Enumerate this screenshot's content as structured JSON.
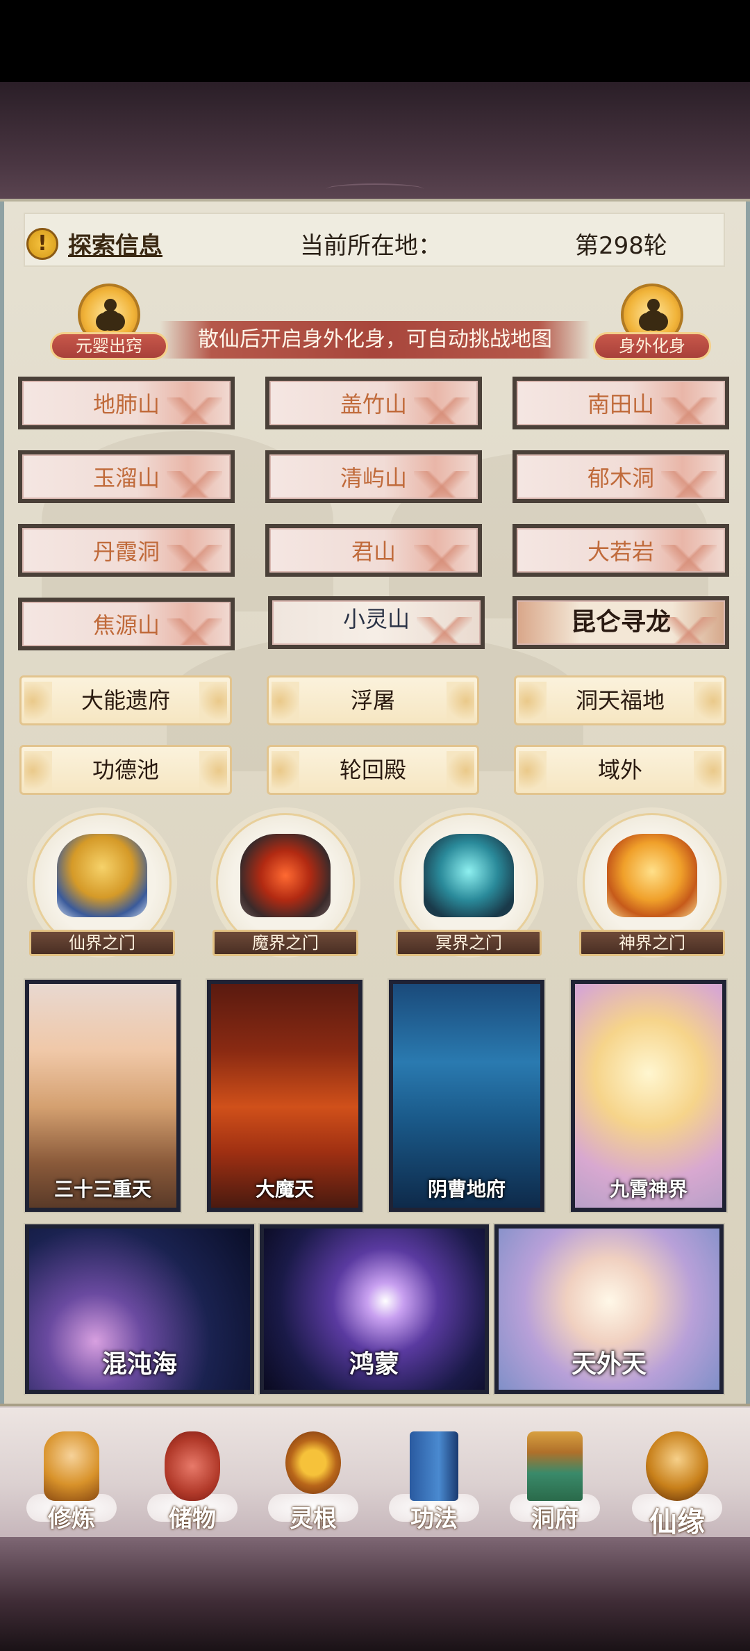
{
  "info_bar": {
    "title": "探索信息",
    "location_label": "当前所在地：",
    "round_text": "第298轮"
  },
  "header": {
    "left_medal": "元婴出窍",
    "right_medal": "身外化身",
    "banner_text": "散仙后开启身外化身，可自动挑战地图"
  },
  "maps": [
    {
      "label": "地肺山"
    },
    {
      "label": "盖竹山"
    },
    {
      "label": "南田山"
    },
    {
      "label": "玉溜山"
    },
    {
      "label": "清屿山"
    },
    {
      "label": "郁木洞"
    },
    {
      "label": "丹霞洞"
    },
    {
      "label": "君山"
    },
    {
      "label": "大若岩"
    },
    {
      "label": "焦源山"
    },
    {
      "label": "小灵山"
    },
    {
      "label": "昆仑寻龙"
    }
  ],
  "scroll_buttons": [
    {
      "label": "大能遗府"
    },
    {
      "label": "浮屠"
    },
    {
      "label": "洞天福地"
    },
    {
      "label": "功德池"
    },
    {
      "label": "轮回殿"
    },
    {
      "label": "域外"
    }
  ],
  "portals": [
    {
      "label": "仙界之门",
      "color": "#d9a23a"
    },
    {
      "label": "魔界之门",
      "color": "#b2341c"
    },
    {
      "label": "冥界之门",
      "color": "#2f8f9a"
    },
    {
      "label": "神界之门",
      "color": "#e08a1e"
    }
  ],
  "realms": [
    {
      "label": "三十三重天"
    },
    {
      "label": "大魔天"
    },
    {
      "label": "阴曹地府"
    },
    {
      "label": "九霄神界"
    }
  ],
  "cosmos": [
    {
      "label": "混沌海"
    },
    {
      "label": "鸿蒙"
    },
    {
      "label": "天外天"
    }
  ],
  "nav": [
    {
      "label": "修炼",
      "icon": "meditating-monk-icon"
    },
    {
      "label": "储物",
      "icon": "treasure-bag-icon"
    },
    {
      "label": "灵根",
      "icon": "spirit-root-icon"
    },
    {
      "label": "功法",
      "icon": "scripture-book-icon"
    },
    {
      "label": "洞府",
      "icon": "cave-dwelling-icon"
    },
    {
      "label": "仙缘",
      "icon": "gourd-yin-yang-icon"
    }
  ]
}
